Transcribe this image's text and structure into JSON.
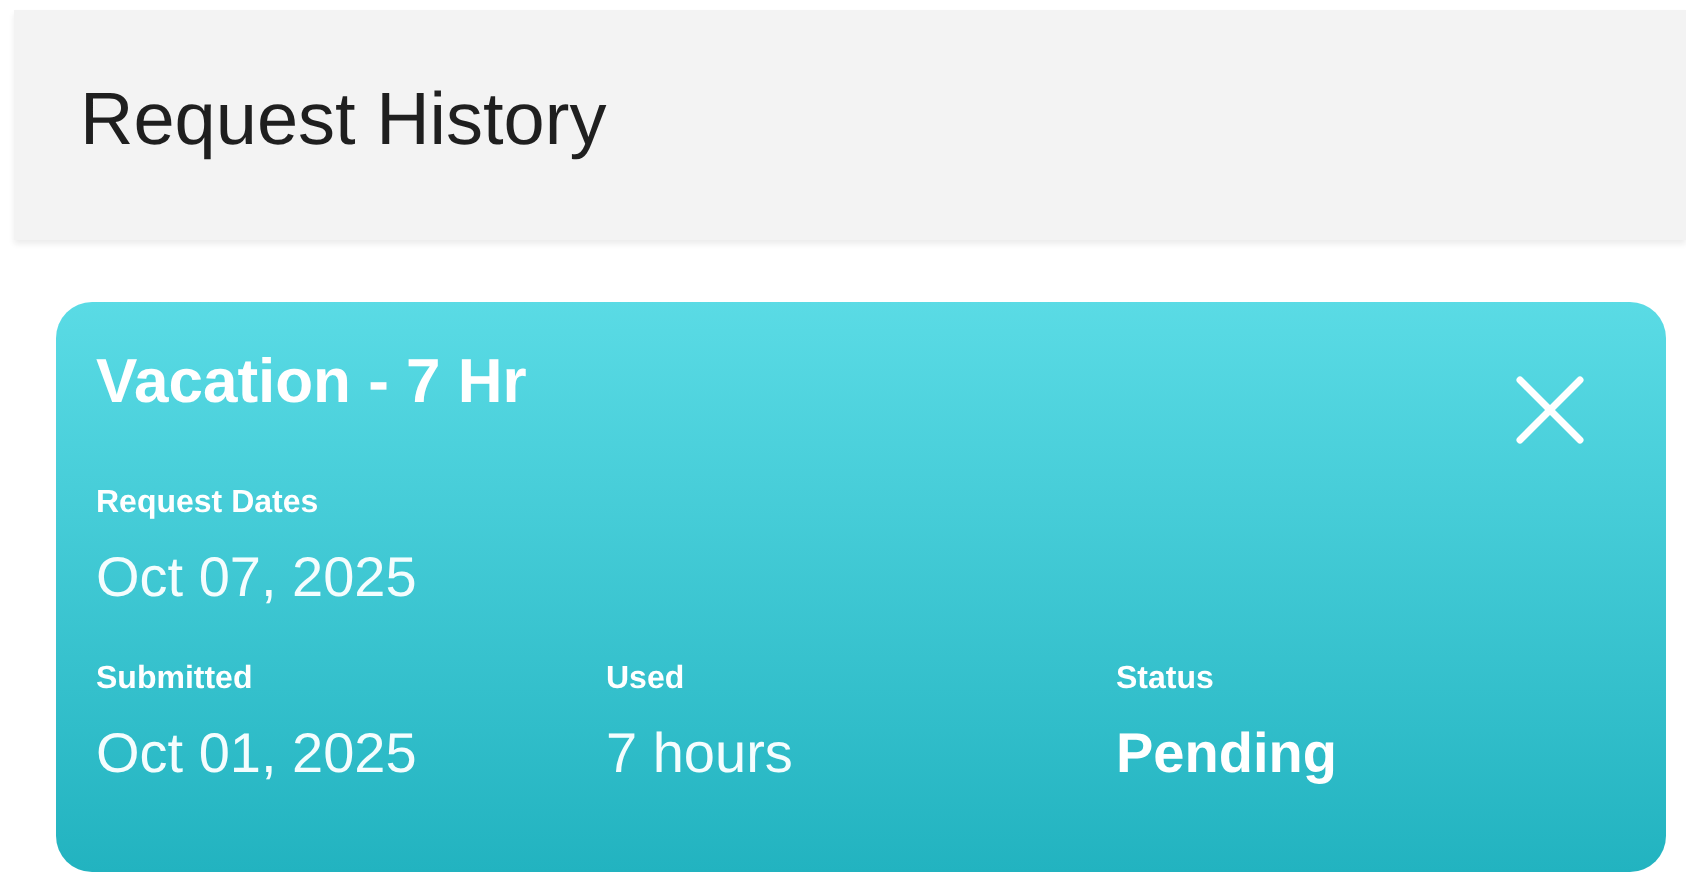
{
  "header": {
    "title": "Request History"
  },
  "request": {
    "title": "Vacation - 7 Hr",
    "dates": {
      "label": "Request Dates",
      "value": "Oct 07, 2025"
    },
    "details": [
      {
        "label": "Submitted",
        "value": "Oct 01, 2025",
        "kind": "plain"
      },
      {
        "label": "Used",
        "value": "7 hours",
        "kind": "plain"
      },
      {
        "label": "Status",
        "value": "Pending",
        "kind": "status"
      }
    ]
  }
}
